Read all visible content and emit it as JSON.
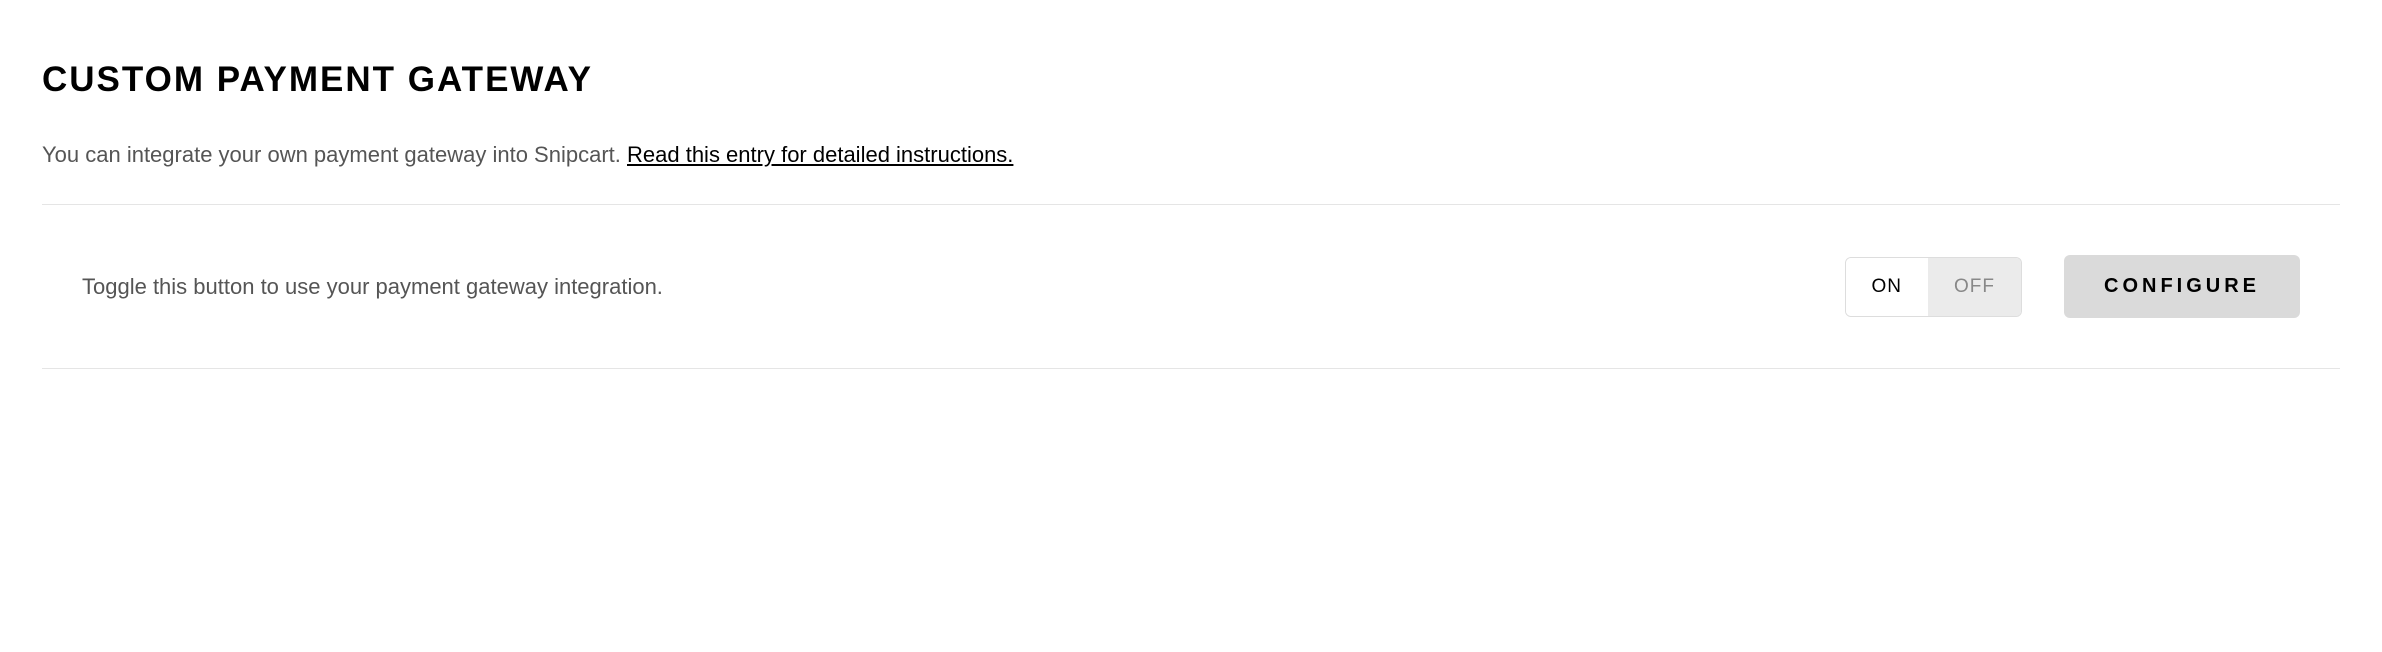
{
  "header": {
    "title": "CUSTOM PAYMENT GATEWAY",
    "description_prefix": "You can integrate your own payment gateway into Snipcart. ",
    "description_link": "Read this entry for detailed instructions."
  },
  "row": {
    "label": "Toggle this button to use your payment gateway integration.",
    "toggle": {
      "on_label": "ON",
      "off_label": "OFF",
      "state": "on"
    },
    "configure_label": "CONFIGURE"
  }
}
